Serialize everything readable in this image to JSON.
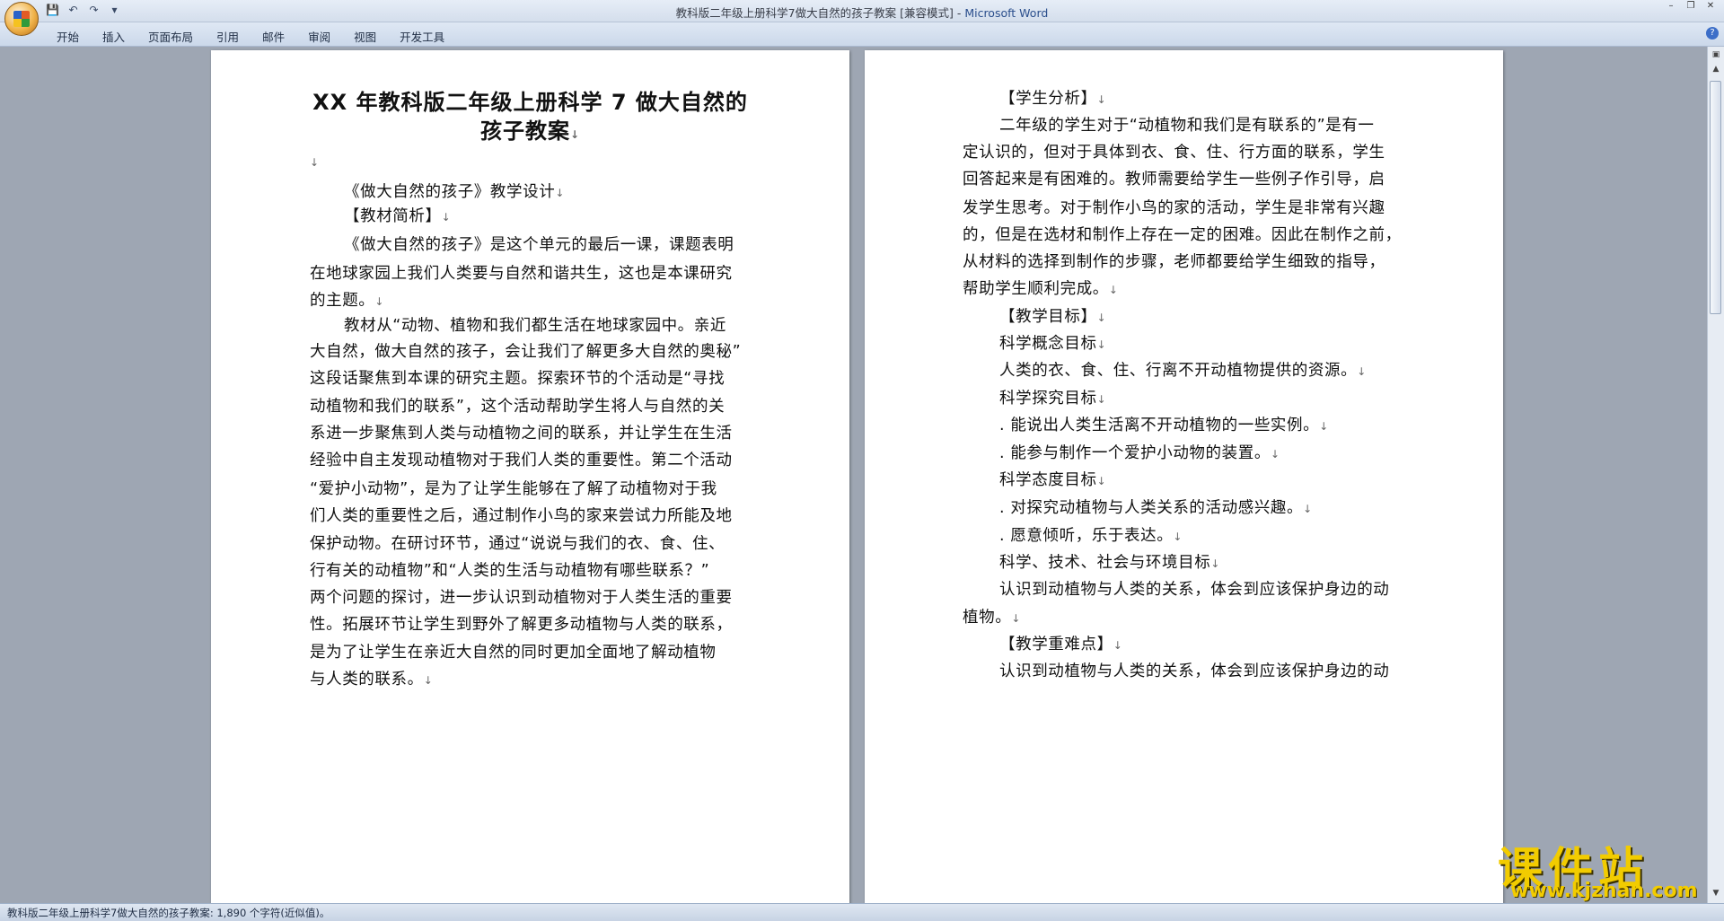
{
  "window": {
    "title": "教科版二年级上册科学7做大自然的孩子教案 [兼容模式] - ",
    "app_name": "Microsoft Word"
  },
  "qat": {
    "save": "💾",
    "undo": "↶",
    "redo": "↷",
    "more": "▾"
  },
  "window_controls": {
    "minimize": "–",
    "restore": "❐",
    "close": "✕"
  },
  "ribbon": {
    "tabs": [
      "开始",
      "插入",
      "页面布局",
      "引用",
      "邮件",
      "审阅",
      "视图",
      "开发工具"
    ],
    "help": "?"
  },
  "page1": {
    "title_lines": [
      "XX 年教科版二年级上册科学 7 做大自然的",
      "孩子教案"
    ],
    "lines": [
      "《做大自然的孩子》教学设计",
      "【教材简析】",
      "《做大自然的孩子》是这个单元的最后一课，课题表明",
      "在地球家园上我们人类要与自然和谐共生，这也是本课研究",
      "的主题。",
      "教材从“动物、植物和我们都生活在地球家园中。亲近",
      "大自然，做大自然的孩子，会让我们了解更多大自然的奥秘”",
      "这段话聚焦到本课的研究主题。探索环节的个活动是“寻找",
      "动植物和我们的联系”，这个活动帮助学生将人与自然的关",
      "系进一步聚焦到人类与动植物之间的联系，并让学生在生活",
      "经验中自主发现动植物对于我们人类的重要性。第二个活动",
      "“爱护小动物”，是为了让学生能够在了解了动植物对于我",
      "们人类的重要性之后，通过制作小鸟的家来尝试力所能及地",
      "保护动物。在研讨环节，通过“说说与我们的衣、食、住、",
      "行有关的动植物”和“人类的生活与动植物有哪些联系？”",
      "两个问题的探讨，进一步认识到动植物对于人类生活的重要",
      "性。拓展环节让学生到野外了解更多动植物与人类的联系，",
      "是为了让学生在亲近大自然的同时更加全面地了解动植物",
      "与人类的联系。"
    ]
  },
  "page2": {
    "lines": [
      "【学生分析】",
      "二年级的学生对于“动植物和我们是有联系的”是有一",
      "定认识的，但对于具体到衣、食、住、行方面的联系，学生",
      "回答起来是有困难的。教师需要给学生一些例子作引导，启",
      "发学生思考。对于制作小鸟的家的活动，学生是非常有兴趣",
      "的，但是在选材和制作上存在一定的困难。因此在制作之前，",
      "从材料的选择到制作的步骤，老师都要给学生细致的指导，",
      "帮助学生顺利完成。",
      "【教学目标】",
      "科学概念目标",
      "人类的衣、食、住、行离不开动植物提供的资源。",
      "科学探究目标",
      ". 能说出人类生活离不开动植物的一些实例。",
      ". 能参与制作一个爱护小动物的装置。",
      "科学态度目标",
      ". 对探究动植物与人类关系的活动感兴趣。",
      ". 愿意倾听，乐于表达。",
      "科学、技术、社会与环境目标",
      "认识到动植物与人类的关系，体会到应该保护身边的动",
      "植物。",
      "【教学重难点】",
      "认识到动植物与人类的关系，体会到应该保护身边的动"
    ]
  },
  "paragraph_mark": "↓",
  "scrollbar": {
    "up": "▲",
    "down": "▼",
    "ruler": "▣"
  },
  "status": {
    "text": "教科版二年级上册科学7做大自然的孩子教案: 1,890 个字符(近似值)。"
  },
  "watermark": {
    "text_cn": "课件站",
    "url": "www.kjzhan.com"
  }
}
